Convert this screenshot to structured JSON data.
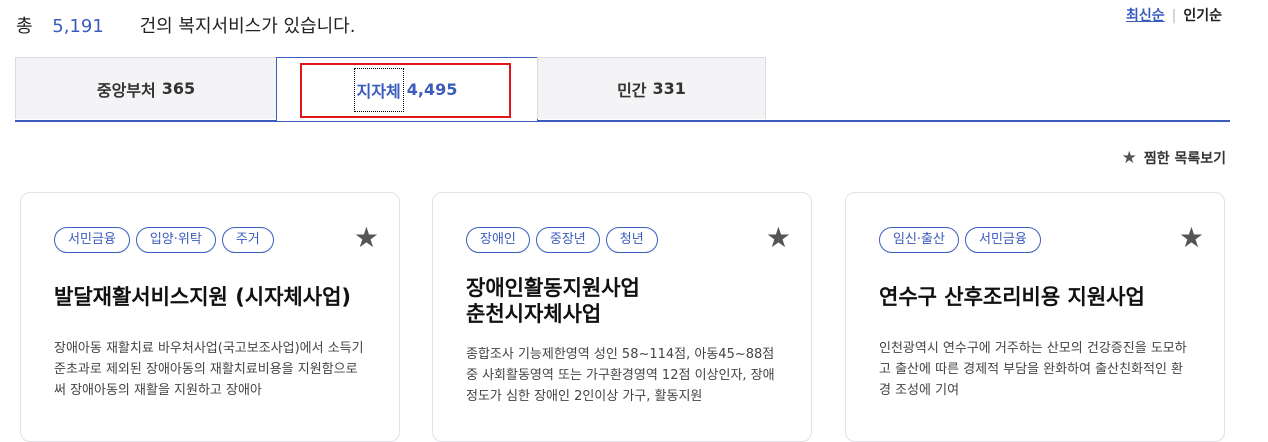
{
  "summary": {
    "prefix": "총",
    "count": "5,191",
    "suffix": "건의 복지서비스가 있습니다."
  },
  "sort": {
    "latest": "최신순",
    "separator": "|",
    "popular": "인기순"
  },
  "tabs": [
    {
      "label": "중앙부처",
      "count": "365"
    },
    {
      "label": "지자체",
      "count": "4,495"
    },
    {
      "label": "민간",
      "count": "331"
    }
  ],
  "favorites": {
    "icon": "star-icon",
    "label": "찜한 목록보기"
  },
  "colors": {
    "accent": "#3b5bbd",
    "highlight": "#e0161b"
  },
  "cards": [
    {
      "tags": [
        "서민금융",
        "입양·위탁",
        "주거"
      ],
      "title": "발달재활서비스지원 (시자체사업)",
      "desc": "장애아동 재활치료 바우처사업(국고보조사업)에서 소득기준초과로 제외된 장애아동의 재활치료비용을 지원함으로써 장애아동의 재활을 지원하고 장애아"
    },
    {
      "tags": [
        "장애인",
        "중장년",
        "청년"
      ],
      "title": "장애인활동지원사업 춘천시자체사업",
      "desc": "종합조사 기능제한영역 성인 58~114점, 아동45~88점 중 사회활동영역 또는 가구환경영역 12점 이상인자, 장애정도가 심한 장애인 2인이상 가구, 활동지원"
    },
    {
      "tags": [
        "임신·출산",
        "서민금융"
      ],
      "title": "연수구 산후조리비용 지원사업",
      "desc": "인천광역시 연수구에 거주하는 산모의 건강증진을 도모하고 출산에 따른 경제적 부담을 완화하여 출산친화적인 환경 조성에 기여"
    }
  ]
}
